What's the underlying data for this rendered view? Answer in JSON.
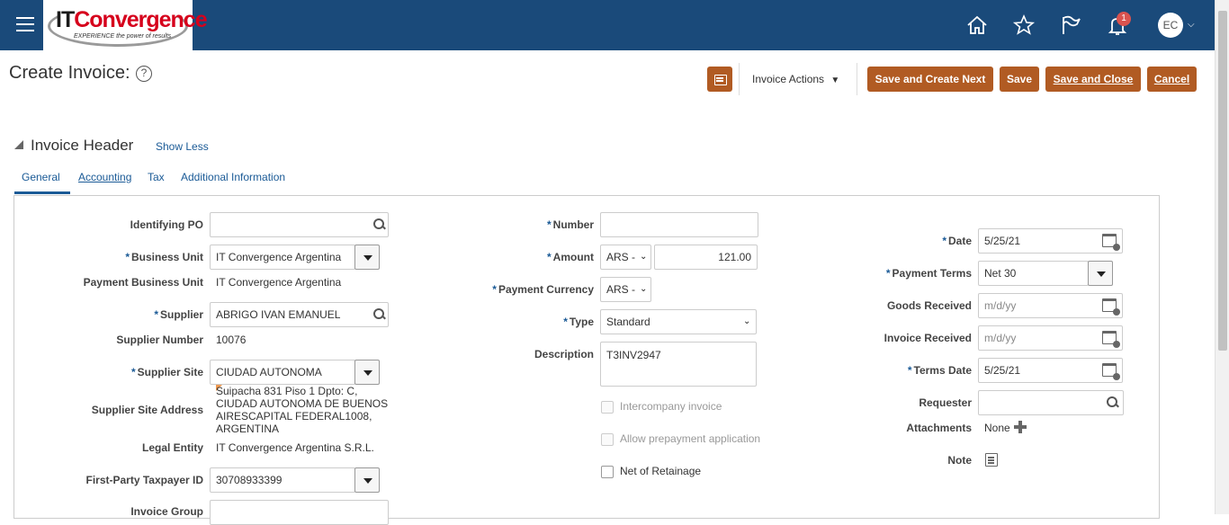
{
  "header": {
    "logo_text_a": "IT",
    "logo_text_b": "Convergence",
    "logo_tagline": "EXPERIENCE the power of results",
    "notification_count": "1",
    "avatar_initials": "EC"
  },
  "page": {
    "title": "Create Invoice:",
    "help_glyph": "?",
    "invoice_actions": "Invoice Actions",
    "buttons": {
      "save_create_next": "Save and Create Next",
      "save": "Save",
      "save_close": "Save and Close",
      "cancel": "Cancel"
    }
  },
  "section": {
    "title": "Invoice Header",
    "show_less": "Show Less"
  },
  "tabs": [
    "General",
    "Accounting",
    "Tax",
    "Additional Information"
  ],
  "form": {
    "identifying_po": {
      "label": "Identifying PO",
      "value": ""
    },
    "business_unit": {
      "label": "Business Unit",
      "value": "IT Convergence Argentina"
    },
    "payment_business_unit": {
      "label": "Payment Business Unit",
      "value": "IT Convergence Argentina"
    },
    "supplier": {
      "label": "Supplier",
      "value": "ABRIGO IVAN EMANUEL"
    },
    "supplier_number": {
      "label": "Supplier Number",
      "value": "10076"
    },
    "supplier_site": {
      "label": "Supplier Site",
      "value": "CIUDAD AUTONOMA"
    },
    "supplier_site_address": {
      "label": "Supplier Site Address",
      "value": "Suipacha 831 Piso 1 Dpto: C, CIUDAD AUTONOMA DE BUENOS AIRESCAPITAL FEDERAL1008, ARGENTINA"
    },
    "legal_entity": {
      "label": "Legal Entity",
      "value": "IT Convergence Argentina S.R.L."
    },
    "first_party_taxpayer_id": {
      "label": "First-Party Taxpayer ID",
      "value": "30708933399"
    },
    "invoice_group": {
      "label": "Invoice Group",
      "value": ""
    },
    "number": {
      "label": "Number",
      "value": ""
    },
    "amount": {
      "label": "Amount",
      "currency": "ARS -",
      "value": "121.00"
    },
    "payment_currency": {
      "label": "Payment Currency",
      "value": "ARS -"
    },
    "type": {
      "label": "Type",
      "value": "Standard"
    },
    "description": {
      "label": "Description",
      "value": "T3INV2947"
    },
    "intercompany": {
      "label": "Intercompany invoice"
    },
    "allow_prepayment": {
      "label": "Allow prepayment application"
    },
    "net_of_retainage": {
      "label": "Net of Retainage"
    },
    "date": {
      "label": "Date",
      "value": "5/25/21"
    },
    "payment_terms": {
      "label": "Payment Terms",
      "value": "Net 30"
    },
    "goods_received": {
      "label": "Goods Received",
      "placeholder": "m/d/yy"
    },
    "invoice_received": {
      "label": "Invoice Received",
      "placeholder": "m/d/yy"
    },
    "terms_date": {
      "label": "Terms Date",
      "value": "5/25/21"
    },
    "requester": {
      "label": "Requester",
      "value": ""
    },
    "attachments": {
      "label": "Attachments",
      "value": "None"
    },
    "note": {
      "label": "Note"
    }
  },
  "required_marker": "*"
}
